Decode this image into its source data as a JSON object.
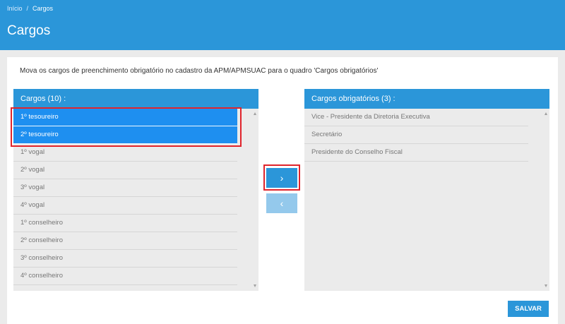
{
  "breadcrumb": {
    "home": "Início",
    "separator": "/",
    "current": "Cargos"
  },
  "page": {
    "title": "Cargos"
  },
  "instruction": "Mova os cargos de preenchimento obrigatório no cadastro da APM/APMSUAC para o quadro 'Cargos obrigatórios'",
  "left_panel": {
    "title": "Cargos (10) :",
    "items": [
      {
        "label": "1º tesoureiro",
        "selected": true
      },
      {
        "label": "2º tesoureiro",
        "selected": true
      },
      {
        "label": "1º vogal",
        "selected": false
      },
      {
        "label": "2º vogal",
        "selected": false
      },
      {
        "label": "3º vogal",
        "selected": false
      },
      {
        "label": "4º vogal",
        "selected": false
      },
      {
        "label": "1º conselheiro",
        "selected": false
      },
      {
        "label": "2º conselheiro",
        "selected": false
      },
      {
        "label": "3º conselheiro",
        "selected": false
      },
      {
        "label": "4º conselheiro",
        "selected": false
      }
    ]
  },
  "right_panel": {
    "title": "Cargos obrigatórios (3) :",
    "items": [
      {
        "label": "Vice - Presidente da Diretoria Executiva"
      },
      {
        "label": "Secretário"
      },
      {
        "label": "Presidente do Conselho Fiscal"
      }
    ]
  },
  "buttons": {
    "move_right": "›",
    "move_left": "‹",
    "save": "SALVAR"
  },
  "colors": {
    "primary": "#2b96d9",
    "selected": "#1e8ff0",
    "highlight": "#e0242c"
  }
}
